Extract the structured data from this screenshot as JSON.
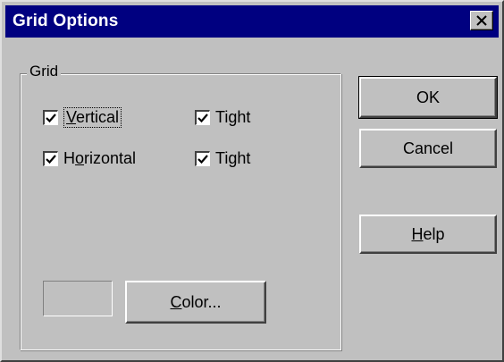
{
  "window": {
    "title": "Grid Options",
    "close_glyph": "×"
  },
  "group": {
    "label": "Grid",
    "rows": [
      {
        "label_pre": "",
        "label_mnemonic": "V",
        "label_post": "ertical",
        "checked": true,
        "tight": {
          "label": "Tight",
          "checked": true
        }
      },
      {
        "label_pre": "H",
        "label_mnemonic": "o",
        "label_post": "rizontal",
        "checked": true,
        "tight": {
          "label": "Tight",
          "checked": true
        }
      }
    ],
    "color_button": {
      "mnemonic": "C",
      "rest": "olor..."
    }
  },
  "buttons": {
    "ok": "OK",
    "cancel": "Cancel",
    "help": {
      "mnemonic": "H",
      "rest": "elp"
    }
  },
  "colors": {
    "title_bar": "#000080",
    "face": "#c0c0c0"
  }
}
